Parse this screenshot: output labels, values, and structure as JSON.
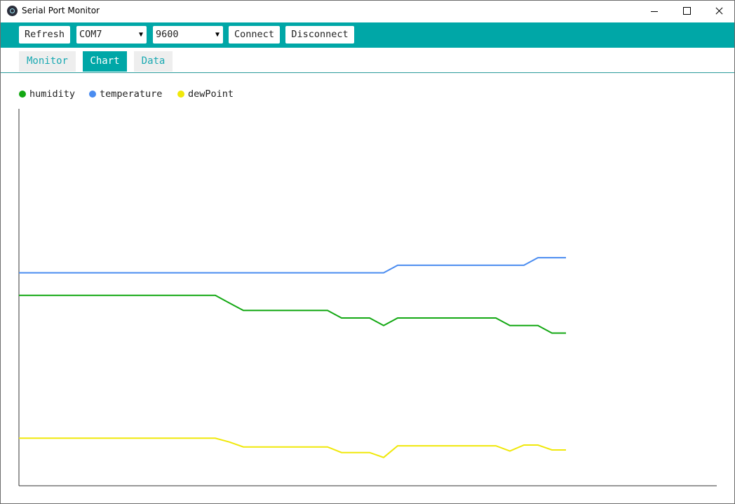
{
  "window": {
    "title": "Serial Port Monitor"
  },
  "toolbar": {
    "refresh_label": "Refresh",
    "port_value": "COM7",
    "baud_value": "9600",
    "connect_label": "Connect",
    "disconnect_label": "Disconnect"
  },
  "tabs": [
    {
      "label": "Monitor",
      "active": false
    },
    {
      "label": "Chart",
      "active": true
    },
    {
      "label": "Data",
      "active": false
    }
  ],
  "colors": {
    "accent": "#00a7a7",
    "humidity": "#13a813",
    "temperature": "#4a8cf0",
    "dewPoint": "#f0e80a"
  },
  "chart_data": {
    "type": "line",
    "title": "",
    "xlabel": "",
    "ylabel": "",
    "grid": false,
    "legend_position": "top-left",
    "ylim": [
      0,
      100
    ],
    "x": [
      0,
      1,
      2,
      3,
      4,
      5,
      6,
      7,
      8,
      9,
      10,
      11,
      12,
      13,
      14,
      15,
      16,
      17,
      18,
      19,
      20,
      21,
      22,
      23,
      24,
      25,
      26,
      27,
      28,
      29,
      30,
      31,
      32,
      33,
      34,
      35,
      36,
      37,
      38,
      39
    ],
    "series": [
      {
        "name": "humidity",
        "color": "#13a813",
        "values": [
          50.5,
          50.5,
          50.5,
          50.5,
          50.5,
          50.5,
          50.5,
          50.5,
          50.5,
          50.5,
          50.5,
          50.5,
          50.5,
          50.5,
          50.5,
          48.5,
          46.5,
          46.5,
          46.5,
          46.5,
          46.5,
          46.5,
          46.5,
          44.5,
          44.5,
          44.5,
          42.5,
          44.5,
          44.5,
          44.5,
          44.5,
          44.5,
          44.5,
          44.5,
          44.5,
          42.5,
          42.5,
          42.5,
          40.5,
          40.5
        ]
      },
      {
        "name": "temperature",
        "color": "#4a8cf0",
        "values": [
          56.5,
          56.5,
          56.5,
          56.5,
          56.5,
          56.5,
          56.5,
          56.5,
          56.5,
          56.5,
          56.5,
          56.5,
          56.5,
          56.5,
          56.5,
          56.5,
          56.5,
          56.5,
          56.5,
          56.5,
          56.5,
          56.5,
          56.5,
          56.5,
          56.5,
          56.5,
          56.5,
          58.5,
          58.5,
          58.5,
          58.5,
          58.5,
          58.5,
          58.5,
          58.5,
          58.5,
          58.5,
          60.5,
          60.5,
          60.5
        ]
      },
      {
        "name": "dewPoint",
        "color": "#f0e80a",
        "values": [
          12.6,
          12.6,
          12.6,
          12.6,
          12.6,
          12.6,
          12.6,
          12.6,
          12.6,
          12.6,
          12.6,
          12.6,
          12.6,
          12.6,
          12.6,
          11.6,
          10.3,
          10.3,
          10.3,
          10.3,
          10.3,
          10.3,
          10.3,
          8.8,
          8.8,
          8.8,
          7.5,
          10.6,
          10.6,
          10.6,
          10.6,
          10.6,
          10.6,
          10.6,
          10.6,
          9.2,
          10.8,
          10.8,
          9.5,
          9.5
        ]
      }
    ]
  }
}
